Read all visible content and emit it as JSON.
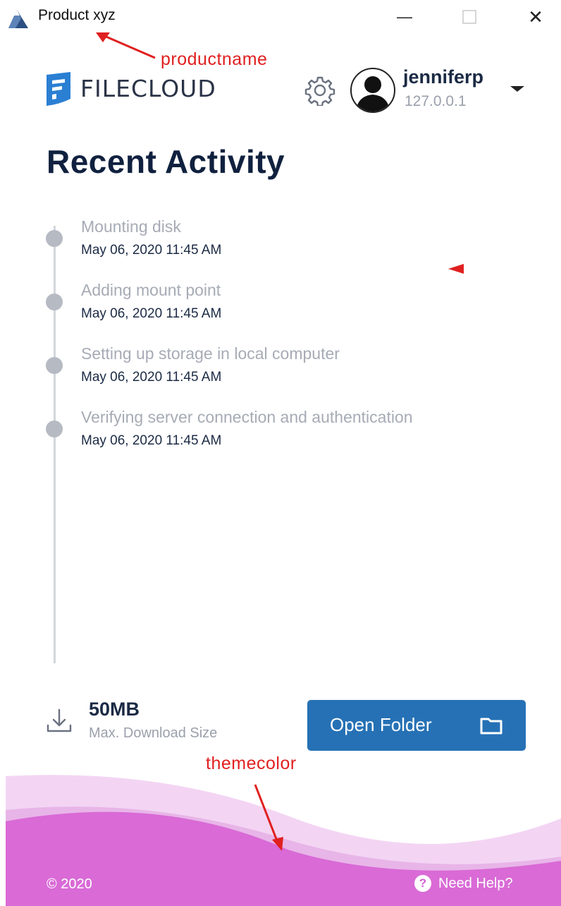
{
  "window": {
    "title": "Product xyz",
    "minimize_glyph": "—",
    "close_glyph": "✕"
  },
  "annotations": {
    "productname": "productname",
    "themecolor": "themecolor"
  },
  "header": {
    "logo_text": "FILECLOUD",
    "username": "jenniferp",
    "server": "127.0.0.1"
  },
  "page": {
    "title": "Recent Activity"
  },
  "activity": [
    {
      "text": "Mounting disk",
      "date": "May 06, 2020 11:45 AM"
    },
    {
      "text": "Adding mount point",
      "date": "May 06, 2020 11:45 AM"
    },
    {
      "text": "Setting up storage in local computer",
      "date": "May 06, 2020 11:45 AM"
    },
    {
      "text": "Verifying server connection and authentication",
      "date": "May 06, 2020 11:45 AM"
    }
  ],
  "download": {
    "size": "50MB",
    "label": "Max. Download Size"
  },
  "actions": {
    "open_folder": "Open Folder"
  },
  "footer": {
    "copyright": "© 2020",
    "help_glyph": "?",
    "help": "Need Help?"
  },
  "colors": {
    "theme": "#d96ad6",
    "theme_light": "#efc9ef",
    "primary": "#2671b5",
    "annotation": "#e02020"
  },
  "icons": {
    "app": "mountain-icon",
    "logo": "filecloud-logo-icon",
    "settings": "gear-icon",
    "avatar": "user-silhouette-icon",
    "dropdown": "caret-down-icon",
    "download": "download-icon",
    "folder": "folder-icon",
    "help": "help-icon"
  }
}
